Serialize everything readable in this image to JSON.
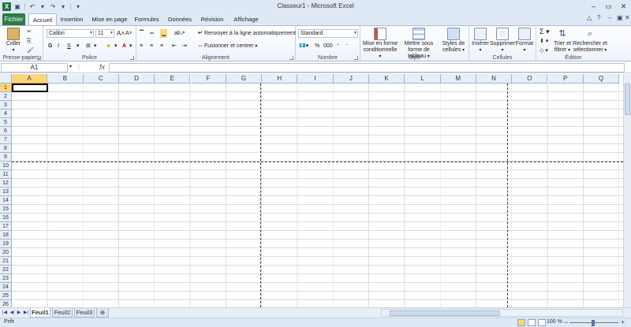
{
  "window": {
    "title": "Classeur1 - Microsoft Excel"
  },
  "qat": {
    "logo": "X",
    "save_icon": "save-icon",
    "undo_icon": "undo-icon",
    "redo_icon": "redo-icon"
  },
  "tabs": {
    "file": "Fichier",
    "items": [
      "Accueil",
      "Insertion",
      "Mise en page",
      "Formules",
      "Données",
      "Révision",
      "Affichage"
    ]
  },
  "ribbon": {
    "clipboard": {
      "paste": "Coller",
      "label": "Presse-papiers"
    },
    "font": {
      "name": "Calibri",
      "size": "11",
      "bold": "G",
      "italic": "I",
      "underline": "S",
      "label": "Police"
    },
    "alignment": {
      "wrap": "Renvoyer à la ligne automatiquement",
      "merge": "Fusionner et centrer",
      "label": "Alignement"
    },
    "number": {
      "format": "Standard",
      "percent": "%",
      "thousands": "000",
      "label": "Nombre"
    },
    "styles": {
      "cond": "Mise en forme conditionnelle",
      "table": "Mettre sous forme de tableau",
      "cell": "Styles de cellules",
      "label": "Style"
    },
    "cells": {
      "insert": "Insérer",
      "delete": "Supprimer",
      "format": "Format",
      "label": "Cellules"
    },
    "editing": {
      "sort": "Trier et filtrer",
      "find": "Rechercher et sélectionner",
      "label": "Édition"
    }
  },
  "formula_bar": {
    "name_box": "A1",
    "fx": "fx",
    "value": ""
  },
  "grid": {
    "columns": [
      "A",
      "B",
      "C",
      "D",
      "E",
      "F",
      "G",
      "H",
      "I",
      "J",
      "K",
      "L",
      "M",
      "N",
      "O",
      "P",
      "Q"
    ],
    "rows": [
      "1",
      "2",
      "3",
      "4",
      "5",
      "6",
      "7",
      "8",
      "9",
      "10",
      "11",
      "12",
      "13",
      "14",
      "15",
      "16",
      "17",
      "18",
      "19",
      "20",
      "21",
      "22",
      "23",
      "24",
      "25",
      "26"
    ],
    "active_cell": "A1"
  },
  "sheets": [
    "Feuil1",
    "Feuil2",
    "Feuil3"
  ],
  "status": {
    "ready": "Prêt",
    "zoom": "100 %"
  },
  "colors": {
    "file_tab": "#2b7c43",
    "selected_header": "#f9d67d"
  }
}
